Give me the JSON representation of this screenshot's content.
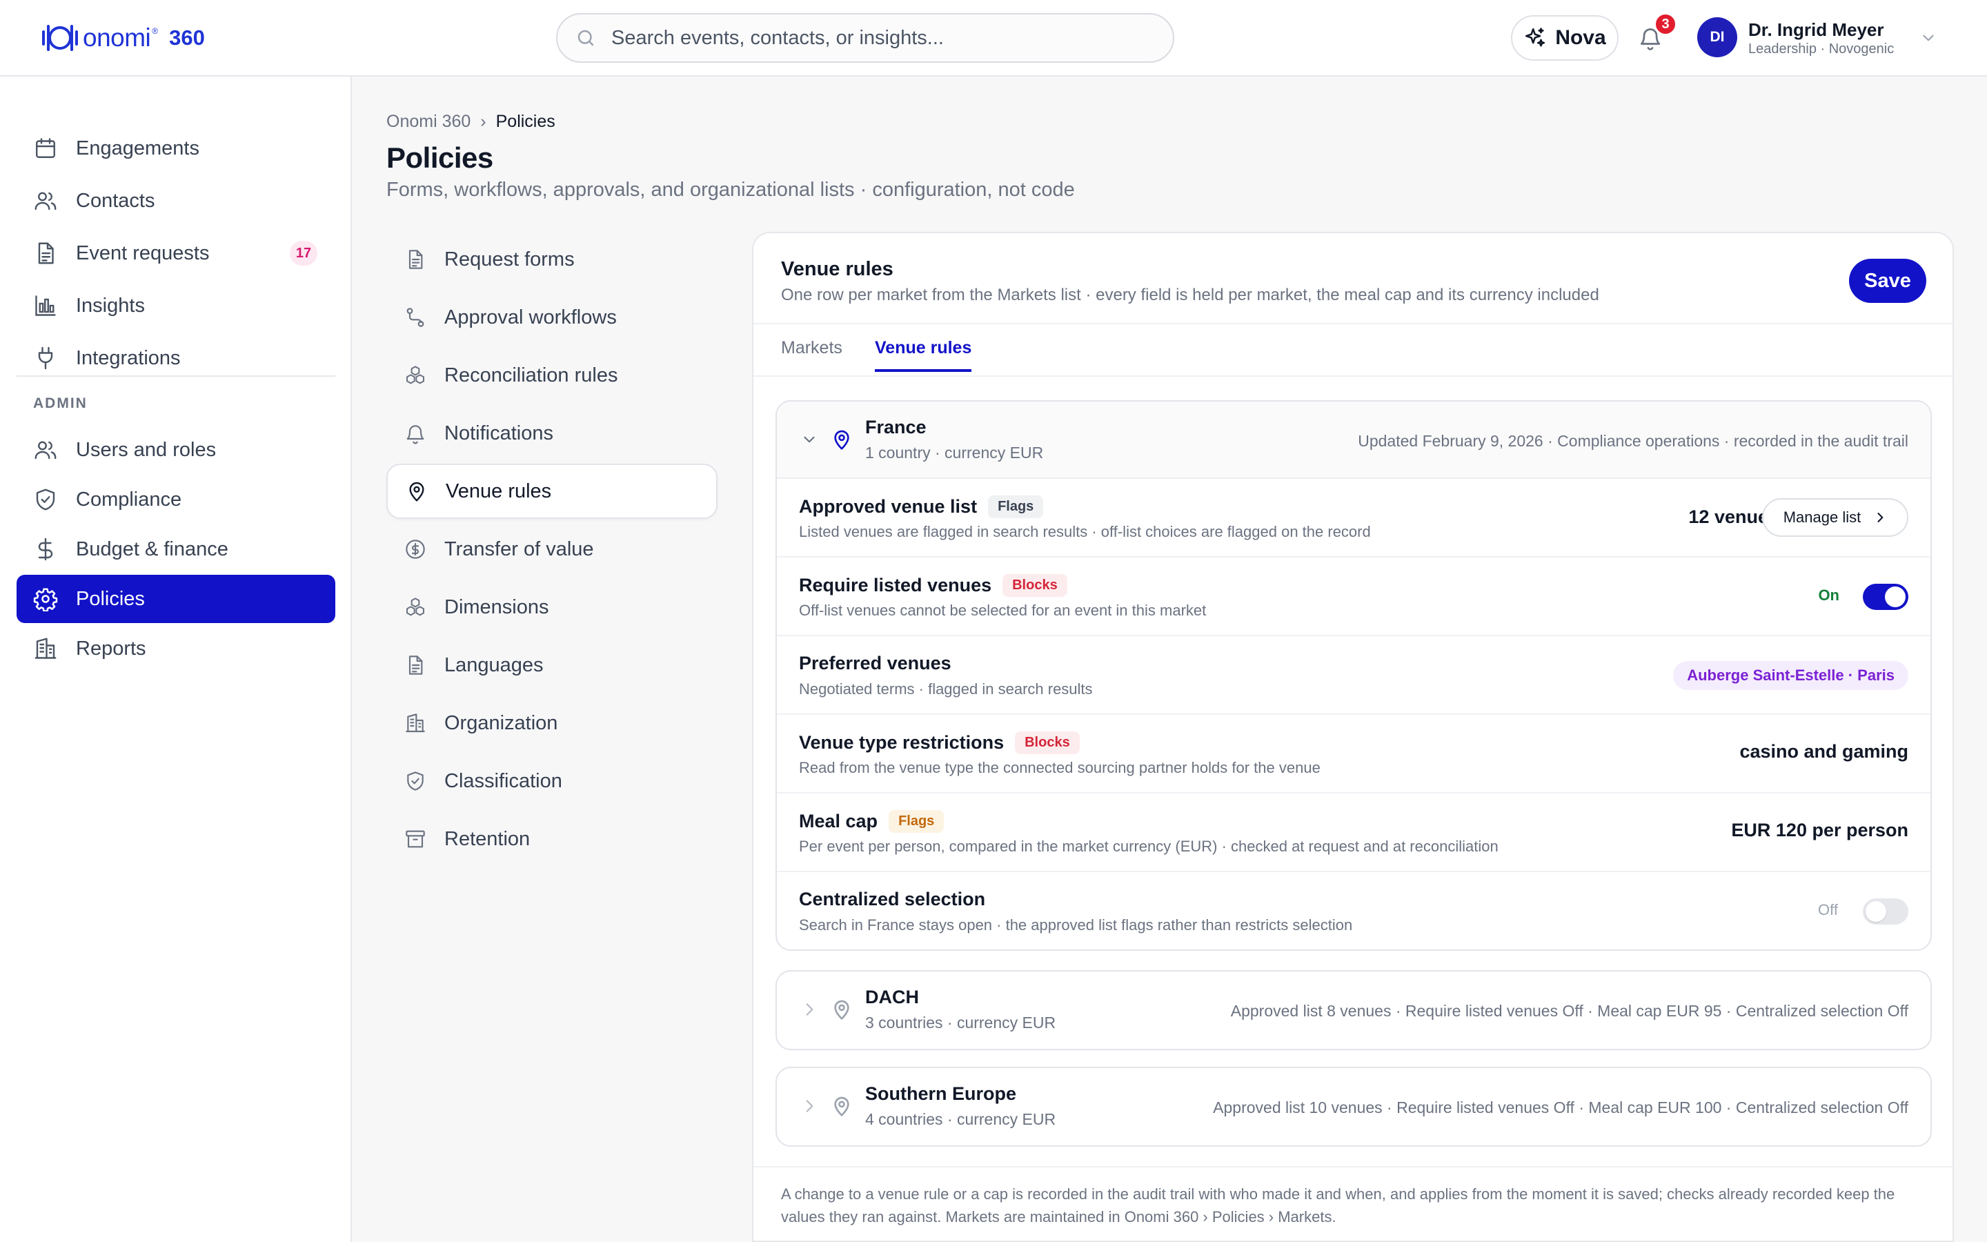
{
  "brand": {
    "wordmark": "onomi",
    "reg": "®",
    "product": "360",
    "color": "#1f33d6"
  },
  "search": {
    "placeholder": "Search events, contacts, or insights..."
  },
  "assistant": {
    "label": "Nova"
  },
  "notifications": {
    "count": "3"
  },
  "user": {
    "initials": "DI",
    "name": "Dr. Ingrid Meyer",
    "role": "Leadership · Novogenic"
  },
  "sidebar": {
    "items": [
      {
        "label": "Engagements",
        "icon": "calendar-icon"
      },
      {
        "label": "Contacts",
        "icon": "users-icon"
      },
      {
        "label": "Event requests",
        "icon": "document-icon",
        "count": "17"
      },
      {
        "label": "Insights",
        "icon": "bar-chart-icon"
      },
      {
        "label": "Integrations",
        "icon": "plug-icon"
      }
    ],
    "admin_label": "ADMIN",
    "admin_items": [
      {
        "label": "Users and roles",
        "icon": "users-icon"
      },
      {
        "label": "Compliance",
        "icon": "shield-check-icon"
      },
      {
        "label": "Budget & finance",
        "icon": "dollar-icon"
      },
      {
        "label": "Policies",
        "icon": "gear-icon",
        "active": true
      },
      {
        "label": "Reports",
        "icon": "building-icon"
      }
    ],
    "active_color": "#1212c9"
  },
  "breadcrumb": {
    "root": "Onomi 360",
    "current": "Policies"
  },
  "page": {
    "title": "Policies",
    "subtitle": "Forms, workflows, approvals, and organizational lists · configuration, not code"
  },
  "policy_nav": [
    {
      "label": "Request forms",
      "icon": "document-icon"
    },
    {
      "label": "Approval workflows",
      "icon": "workflow-icon"
    },
    {
      "label": "Reconciliation rules",
      "icon": "cubes-icon"
    },
    {
      "label": "Notifications",
      "icon": "bell-icon"
    },
    {
      "label": "Venue rules",
      "icon": "map-pin-icon",
      "active": true
    },
    {
      "label": "Transfer of value",
      "icon": "dollar-circle-icon"
    },
    {
      "label": "Dimensions",
      "icon": "cubes-icon"
    },
    {
      "label": "Languages",
      "icon": "document-icon"
    },
    {
      "label": "Organization",
      "icon": "building-icon"
    },
    {
      "label": "Classification",
      "icon": "shield-check-icon"
    },
    {
      "label": "Retention",
      "icon": "archive-icon"
    }
  ],
  "panel": {
    "title": "Venue rules",
    "subtitle": "One row per market from the Markets list · every field is held per market, the meal cap and its currency included",
    "save_label": "Save",
    "tabs": [
      {
        "label": "Markets",
        "active": false
      },
      {
        "label": "Venue rules",
        "active": true
      }
    ],
    "footer": "A change to a venue rule or a cap is recorded in the audit trail with who made it and when, and applies from the moment it is saved; checks already recorded keep the values they ran against. Markets are maintained in Onomi 360 › Policies › Markets."
  },
  "markets": {
    "france": {
      "name": "France",
      "meta": "1 country · currency EUR",
      "updated": "Updated February 9, 2026 · Compliance operations · recorded in the audit trail",
      "rules": {
        "approved_list": {
          "title": "Approved venue list",
          "tag": "Flags",
          "desc": "Listed venues are flagged in search results · off-list choices are flagged on the record",
          "value": "12 venues",
          "button": "Manage list"
        },
        "require_listed": {
          "title": "Require listed venues",
          "tag": "Blocks",
          "desc": "Off-list venues cannot be selected for an event in this market",
          "state": "On"
        },
        "preferred": {
          "title": "Preferred venues",
          "desc": "Negotiated terms · flagged in search results",
          "venue": "Auberge Saint-Estelle · Paris"
        },
        "type_restrictions": {
          "title": "Venue type restrictions",
          "tag": "Blocks",
          "desc": "Read from the venue type the connected sourcing partner holds for the venue",
          "value": "casino and gaming"
        },
        "meal_cap": {
          "title": "Meal cap",
          "tag": "Flags",
          "desc": "Per event per person, compared in the market currency (EUR) · checked at request and at reconciliation",
          "value": "EUR 120 per person"
        },
        "centralized": {
          "title": "Centralized selection",
          "desc": "Search in France stays open · the approved list flags rather than restricts selection",
          "state": "Off"
        }
      }
    },
    "dach": {
      "name": "DACH",
      "meta": "3 countries · currency EUR",
      "summary": "Approved list 8 venues · Require listed venues Off · Meal cap EUR 95 · Centralized selection Off"
    },
    "southern_europe": {
      "name": "Southern Europe",
      "meta": "4 countries · currency EUR",
      "summary": "Approved list 10 venues · Require listed venues Off · Meal cap EUR 100 · Centralized selection Off"
    }
  }
}
